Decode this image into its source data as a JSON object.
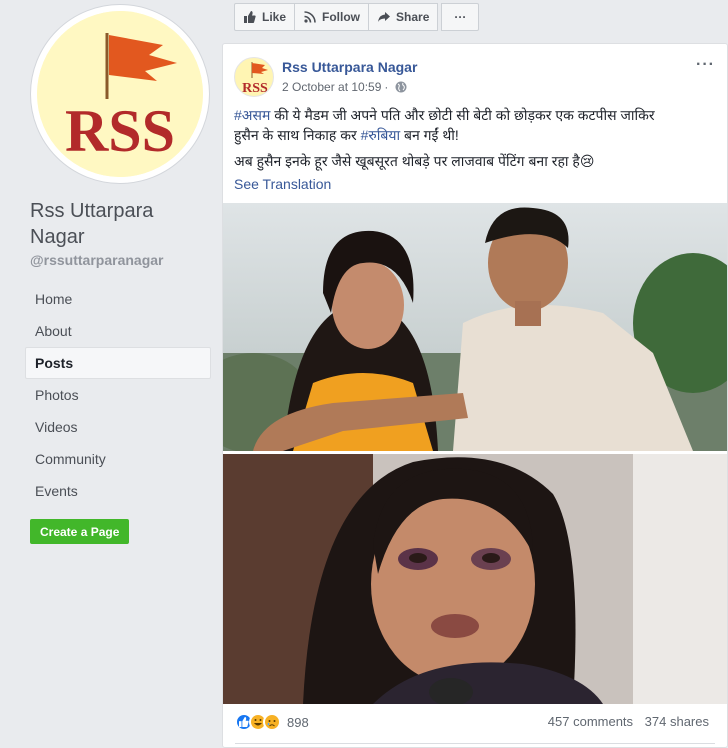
{
  "sidebar": {
    "logo_text": "RSS",
    "page_name": "Rss Uttarpara Nagar",
    "handle": "@rssuttarparanagar",
    "nav": [
      {
        "label": "Home"
      },
      {
        "label": "About"
      },
      {
        "label": "Posts"
      },
      {
        "label": "Photos"
      },
      {
        "label": "Videos"
      },
      {
        "label": "Community"
      },
      {
        "label": "Events"
      }
    ],
    "active_nav": "Posts",
    "create_page_label": "Create a Page"
  },
  "action_bar": {
    "like_label": "Like",
    "follow_label": "Follow",
    "share_label": "Share",
    "more_label": "···"
  },
  "post": {
    "author": "Rss Uttarpara Nagar",
    "timestamp": "2 October at 10:59",
    "separator": "·",
    "more_label": "···",
    "line1_tag": "#असम",
    "line1_text": " की ये मैडम जी अपने पति और छोटी सी बेटी को छोड़कर एक कटपीस जाकिर",
    "line2_text": "हुसैन के साथ निकाह कर ",
    "line2_tag": "#रुबिया",
    "line2_tail": " बन गईं थी!",
    "line3_text": "अब हुसैन इनके हूर जैसे खूबसूरत थोबड़े पर लाजवाब पेंटिंग बना रहा है😢",
    "see_translation": "See Translation",
    "reaction_count": "898",
    "comments": "457 comments",
    "shares": "374 shares"
  },
  "colors": {
    "link": "#385898",
    "create_green": "#42b72a",
    "rss_red": "#b22a2a",
    "flag_orange": "#e2581f"
  }
}
